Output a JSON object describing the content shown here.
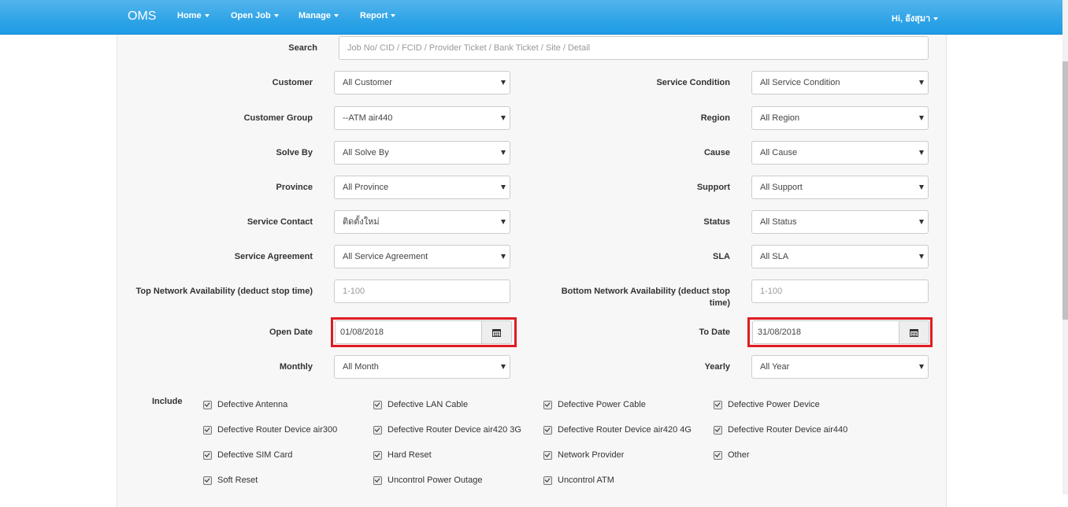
{
  "nav": {
    "brand": "OMS",
    "items": [
      "Home",
      "Open Job",
      "Manage",
      "Report"
    ],
    "user": "Hi, อังสุมา"
  },
  "search": {
    "label": "Search",
    "placeholder": "Job No/ CID / FCID / Provider Ticket / Bank Ticket / Site / Detail"
  },
  "left": {
    "customer": {
      "label": "Customer",
      "value": "All Customer"
    },
    "customer_group": {
      "label": "Customer Group",
      "value": "--ATM air440"
    },
    "solve_by": {
      "label": "Solve By",
      "value": "All Solve By"
    },
    "province": {
      "label": "Province",
      "value": "All Province"
    },
    "service_contact": {
      "label": "Service Contact",
      "value": "ติดตั้งใหม่"
    },
    "service_agreement": {
      "label": "Service Agreement",
      "value": "All Service Agreement"
    },
    "top_na": {
      "label": "Top Network Availability (deduct stop time)",
      "placeholder": "1-100"
    },
    "open_date": {
      "label": "Open Date",
      "value": "01/08/2018"
    },
    "monthly": {
      "label": "Monthly",
      "value": "All Month"
    }
  },
  "right": {
    "service_condition": {
      "label": "Service Condition",
      "value": "All Service Condition"
    },
    "region": {
      "label": "Region",
      "value": "All Region"
    },
    "cause": {
      "label": "Cause",
      "value": "All Cause"
    },
    "support": {
      "label": "Support",
      "value": "All Support"
    },
    "status": {
      "label": "Status",
      "value": "All Status"
    },
    "sla": {
      "label": "SLA",
      "value": "All SLA"
    },
    "bottom_na": {
      "label_line1": "Bottom Network Availability (deduct stop",
      "label_line2": "time)",
      "placeholder": "1-100"
    },
    "to_date": {
      "label": "To Date",
      "value": "31/08/2018"
    },
    "yearly": {
      "label": "Yearly",
      "value": "All Year"
    }
  },
  "include": {
    "label": "Include",
    "items": [
      "Defective Antenna",
      "Defective LAN Cable",
      "Defective Power Cable",
      "Defective Power Device",
      "Defective Router Device air300",
      "Defective Router Device air420 3G",
      "Defective Router Device air420 4G",
      "Defective Router Device air440",
      "Defective SIM Card",
      "Hard Reset",
      "Network Provider",
      "Other",
      "Soft Reset",
      "Uncontrol Power Outage",
      "Uncontrol ATM"
    ]
  }
}
